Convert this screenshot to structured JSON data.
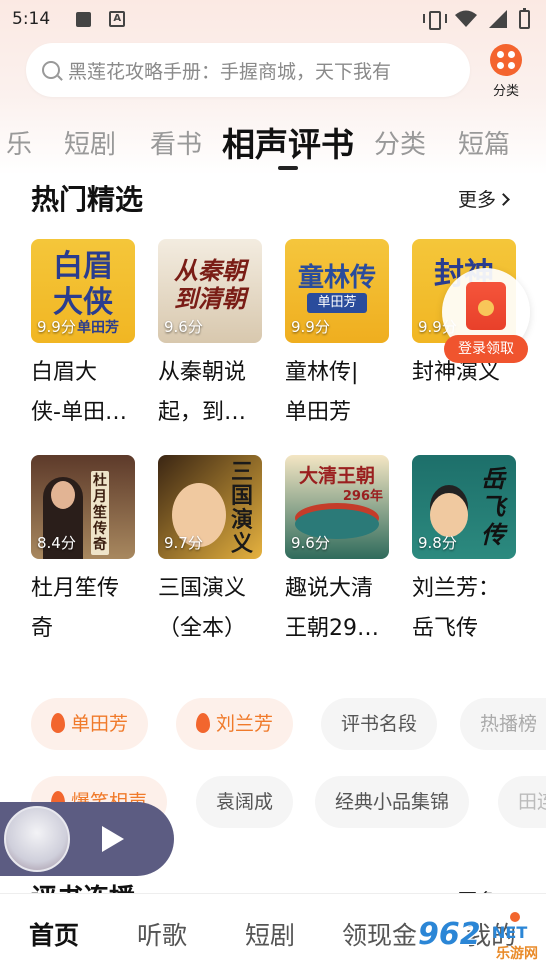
{
  "status_bar": {
    "time": "5:14",
    "a_icon": "A"
  },
  "search": {
    "placeholder": "黑莲花攻略手册：手握商城，天下我有"
  },
  "category": {
    "label": "分类"
  },
  "tabs": [
    "乐",
    "短剧",
    "看书",
    "相声评书",
    "分类",
    "短篇"
  ],
  "active_tab_index": 3,
  "section": {
    "title": "热门精选",
    "more": "更多"
  },
  "books": [
    {
      "title": "白眉大侠-单田…",
      "title_lines": [
        "白眉大",
        "侠-单田…"
      ],
      "score": "9.9分",
      "cover_text": "白眉\n大侠",
      "cover_sub": "单田芳"
    },
    {
      "title": "从秦朝说起，到…",
      "title_lines": [
        "从秦朝说",
        "起，到…"
      ],
      "score": "9.6分",
      "cover_text": "从秦朝\n到清朝"
    },
    {
      "title": "童林传|单田芳",
      "title_lines": [
        "童林传|",
        "单田芳"
      ],
      "score": "9.9分",
      "cover_text": "童林传",
      "cover_sub": "单田芳"
    },
    {
      "title": "封神演义",
      "title_lines": [
        "封神演义"
      ],
      "score": "9.9分",
      "cover_text": "封神"
    },
    {
      "title": "杜月笙传奇",
      "title_lines": [
        "杜月笙传",
        "奇"
      ],
      "score": "8.4分",
      "cover_text": "杜月笙传奇"
    },
    {
      "title": "三国演义（全本）",
      "title_lines": [
        "三国演义",
        "（全本）"
      ],
      "score": "9.7分",
      "cover_text": "三国演义"
    },
    {
      "title": "趣说大清王朝29…",
      "title_lines": [
        "趣说大清",
        "王朝29…"
      ],
      "score": "9.6分",
      "cover_text": "大清王朝",
      "cover_sub": "296年"
    },
    {
      "title": "刘兰芳：岳飞传",
      "title_lines": [
        "刘兰芳：",
        "岳飞传"
      ],
      "score": "9.8分",
      "cover_text": "岳飞传"
    }
  ],
  "envelope": {
    "label": "登录领取"
  },
  "chips_row1": [
    "单田芳",
    "刘兰芳",
    "评书名段",
    "热播榜"
  ],
  "chips_row2": [
    "爆笑相声",
    "袁阔成",
    "经典小品集锦",
    "田连元"
  ],
  "partial_section": {
    "title": "评书连播",
    "more": "更多"
  },
  "bottom_nav": [
    "首页",
    "听歌",
    "短剧",
    "领现金",
    "我的"
  ],
  "active_nav_index": 0,
  "watermark": {
    "brand": "962",
    "domain": "NET",
    "sub": "乐游网"
  },
  "colors": {
    "accent": "#f2662e",
    "tab_active": "#111111",
    "tab_inactive": "#999999"
  }
}
